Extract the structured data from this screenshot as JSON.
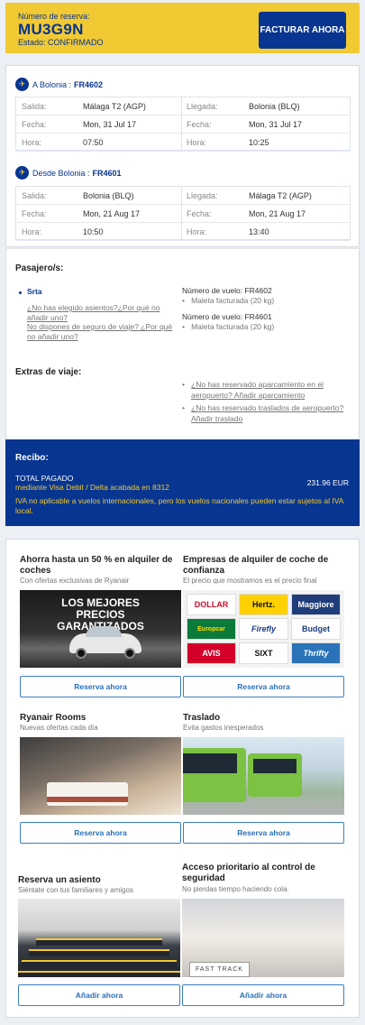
{
  "header": {
    "reservation_label": "Número de reserva:",
    "reservation_code": "MU3G9N",
    "status": "Estado: CONFIRMADO",
    "checkin_button": "FACTURAR AHORA"
  },
  "flights": [
    {
      "title_prefix": "A Bolonia :",
      "flight_number": "FR4602",
      "labels": {
        "departure": "Salida:",
        "date": "Fecha:",
        "time": "Hora:",
        "arrival": "Llegada:"
      },
      "departure": {
        "place": "Málaga T2 (AGP)",
        "date": "Mon, 31 Jul 17",
        "time": "07:50"
      },
      "arrival": {
        "place": "Bolonia (BLQ)",
        "date": "Mon, 31 Jul 17",
        "time": "10:25"
      }
    },
    {
      "title_prefix": "Desde Bolonia :",
      "flight_number": "FR4601",
      "labels": {
        "departure": "Salida:",
        "date": "Fecha:",
        "time": "Hora:",
        "arrival": "Llegada:"
      },
      "departure": {
        "place": "Bolonia (BLQ)",
        "date": "Mon, 21 Aug 17",
        "time": "10:50"
      },
      "arrival": {
        "place": "Málaga T2 (AGP)",
        "date": "Mon, 21 Aug 17",
        "time": "13:40"
      }
    }
  ],
  "passengers": {
    "title": "Pasajero/s:",
    "name": "Srta",
    "seat_link": "¿No has elegido asientos?¿Por qué no añadir uno?",
    "insurance_link": "No dispones de seguro de viaje? ¿Por qué no añadir uno?",
    "flight_label_1": "Número de vuelo: FR4602",
    "baggage_1": "Maleta facturada (20 kg)",
    "flight_label_2": "Número de vuelo: FR4601",
    "baggage_2": "Maleta facturada (20 kg)"
  },
  "extras": {
    "title": "Extras de viaje:",
    "parking_link": "¿No has reservado aparcamiento en el aeropuerto? Añadir aparcamiento",
    "transfer_link": "¿No has reservado traslados de aeropuerto? Añadir traslado"
  },
  "receipt": {
    "title": "Recibo:",
    "total_label": "TOTAL PAGADO",
    "total_value": "231.96 EUR",
    "payment_method": "mediante Visa Debit / Delta acabada en 8312",
    "vat_note": "IVA no aplicable a vuelos internacionales, pero los vuelos nacionales pueden estar sujetos al IVA local."
  },
  "promos": [
    {
      "title": "Ahorra hasta un 50 % en alquiler de coches",
      "subtitle": "Con ofertas exclusivas de Ryanair",
      "image_text": "LOS MEJORES PRECIOS GARANTIZADOS",
      "button": "Reserva ahora"
    },
    {
      "title": "Empresas de alquiler de coche de confianza",
      "subtitle": "El precio que mostramos es el precio final",
      "logos": [
        "DOLLAR",
        "Hertz.",
        "Maggiore",
        "Europcar",
        "Firefly",
        "Budget",
        "AVIS",
        "SIXT",
        "Thrifty"
      ],
      "button": "Reserva ahora"
    },
    {
      "title": "Ryanair Rooms",
      "subtitle": "Nuevas ofertas cada día",
      "button": "Reserva ahora"
    },
    {
      "title": "Traslado",
      "subtitle": "Evita gastos inesperados",
      "button": "Reserva ahora"
    },
    {
      "title": "Reserva un asiento",
      "subtitle": "Siéntate con tus familiares y amigos",
      "button": "Añadir ahora"
    },
    {
      "title": "Acceso prioritario al control de seguridad",
      "subtitle": "No pierdas tiempo haciendo cola.",
      "image_text": "FAST TRACK",
      "button": "Añadir ahora"
    }
  ],
  "colors": {
    "brand_blue": "#073590",
    "brand_yellow": "#f1c933",
    "link_blue": "#2a6fb9"
  }
}
